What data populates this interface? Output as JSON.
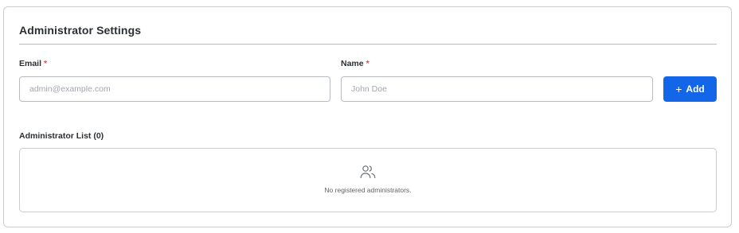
{
  "card": {
    "title": "Administrator Settings"
  },
  "form": {
    "email_label": "Email",
    "email_required": "*",
    "email_placeholder": "admin@example.com",
    "email_value": "",
    "name_label": "Name",
    "name_required": "*",
    "name_placeholder": "John Doe",
    "name_value": "",
    "add_button_icon": "plus-icon",
    "add_button_label": "Add"
  },
  "list": {
    "label": "Administrator List (0)",
    "empty_icon": "users-icon",
    "empty_text": "No registered administrators."
  },
  "colors": {
    "accent": "#1466e8",
    "required": "#e5484d",
    "border": "#c9ccd1"
  }
}
